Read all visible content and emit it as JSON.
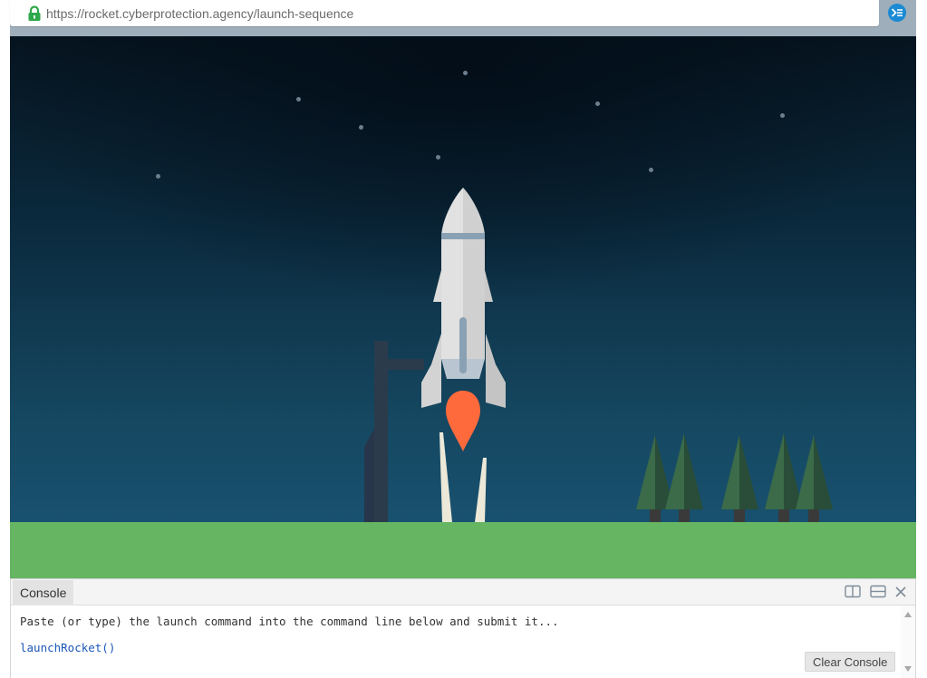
{
  "browser": {
    "url": "https://rocket.cyberprotection.agency/launch-sequence",
    "icons": {
      "lock": "lock-icon",
      "extension": "debugger-extension-icon"
    },
    "colors": {
      "secure_lock": "#2ea84a",
      "extension_accent": "#1a8ad4",
      "chrome_bar": "#9faebb"
    }
  },
  "scene": {
    "colors": {
      "sky_top": "#06141f",
      "sky_bottom": "#1a5677",
      "ground": "#66b563",
      "rocket_body": "#d9d9d9",
      "rocket_band": "#8aa1b4",
      "flame": "#ff6a3d",
      "tower": "#2b3b4c",
      "tree": "#2f5f40"
    },
    "objects": [
      "stars",
      "rocket",
      "launch-tower",
      "exhaust-smoke",
      "pine-trees",
      "ground"
    ]
  },
  "console": {
    "tab_label": "Console",
    "message": "Paste (or type) the launch command into the command line below and submit it...",
    "command": "launchRocket()",
    "clear_button": "Clear Console",
    "header_icons": [
      "split-vertical-icon",
      "split-horizontal-icon",
      "close-icon"
    ]
  }
}
